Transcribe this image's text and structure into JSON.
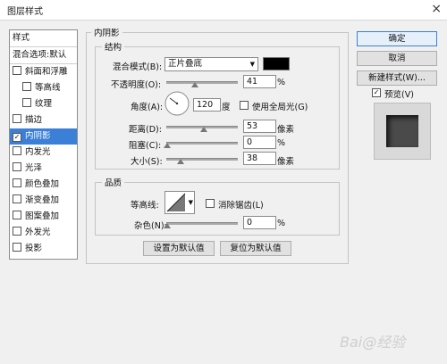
{
  "window": {
    "title": "图层样式",
    "close_glyph": "×"
  },
  "stylelist": {
    "header": "样式",
    "blend": "混合选项:默认",
    "items": [
      {
        "label": "斜面和浮雕",
        "checked": false
      },
      {
        "label": "等高线",
        "checked": false
      },
      {
        "label": "纹理",
        "checked": false
      },
      {
        "label": "描边",
        "checked": false
      },
      {
        "label": "内阴影",
        "checked": true
      },
      {
        "label": "内发光",
        "checked": false
      },
      {
        "label": "光泽",
        "checked": false
      },
      {
        "label": "颜色叠加",
        "checked": false
      },
      {
        "label": "渐变叠加",
        "checked": false
      },
      {
        "label": "图案叠加",
        "checked": false
      },
      {
        "label": "外发光",
        "checked": false
      },
      {
        "label": "投影",
        "checked": false
      }
    ]
  },
  "inner_shadow": {
    "title": "内阴影",
    "structure_title": "结构",
    "blend_mode_label": "混合模式(B):",
    "blend_mode_value": "正片叠底",
    "shadow_color": "#000000",
    "opacity_label": "不透明度(O):",
    "opacity_value": "41",
    "percent": "%",
    "angle_label": "角度(A):",
    "angle_value": "120",
    "degree": "度",
    "global_light_label": "使用全局光(G)",
    "distance_label": "距离(D):",
    "distance_value": "53",
    "choke_label": "阻塞(C):",
    "choke_value": "0",
    "size_label": "大小(S):",
    "size_value": "38",
    "pixels": "像素",
    "quality_title": "品质",
    "contour_label": "等高线:",
    "antialias_label": "消除锯齿(L)",
    "noise_label": "杂色(N):",
    "noise_value": "0",
    "set_default": "设置为默认值",
    "reset_default": "复位为默认值"
  },
  "buttons": {
    "ok": "确定",
    "cancel": "取消",
    "new_style": "新建样式(W)...",
    "preview_label": "预览(V)",
    "preview_checked": true
  },
  "watermark": "Bai@经验"
}
